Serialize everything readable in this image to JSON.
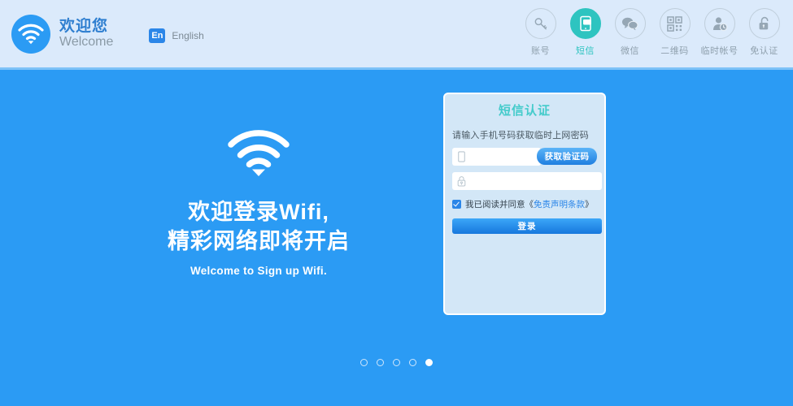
{
  "header": {
    "brand": {
      "icon": "wifi-icon",
      "title_cn": "欢迎您",
      "title_en": "Welcome"
    },
    "language": {
      "badge": "En",
      "label": "English"
    },
    "tabs": [
      {
        "label": "账号",
        "icon": "key-icon",
        "active": false
      },
      {
        "label": "短信",
        "icon": "sms-phone-icon",
        "active": true
      },
      {
        "label": "微信",
        "icon": "wechat-icon",
        "active": false
      },
      {
        "label": "二维码",
        "icon": "qrcode-icon",
        "active": false
      },
      {
        "label": "临时帐号",
        "icon": "temp-user-icon",
        "active": false
      },
      {
        "label": "免认证",
        "icon": "unlock-icon",
        "active": false
      }
    ]
  },
  "hero": {
    "icon": "wifi-large-icon",
    "line1": "欢迎登录Wifi,",
    "line2": "精彩网络即将开启",
    "subtitle": "Welcome to Sign up Wifi."
  },
  "carousel": {
    "total": 5,
    "active_index": 5
  },
  "login_card": {
    "title": "短信认证",
    "hint": "请输入手机号码获取临时上网密码",
    "phone_field": {
      "icon": "mobile-phone-icon",
      "value": "",
      "placeholder": ""
    },
    "code_button": "获取验证码",
    "password_field": {
      "icon": "lock-icon",
      "value": "",
      "placeholder": ""
    },
    "agreement": {
      "checked": true,
      "text": "我已阅读并同意",
      "bracket_open": "《",
      "link": "免责声明条款",
      "bracket_close": "》"
    },
    "login_button": "登录"
  },
  "colors": {
    "page_blue": "#2b9bf4",
    "header_blue": "#dbeafb",
    "header_rule": "#7dc2f7",
    "card_bg": "#d3e7f7",
    "active_tab": "#2ec4c0",
    "title_teal": "#44cbcb",
    "link_blue": "#2b86e8"
  }
}
